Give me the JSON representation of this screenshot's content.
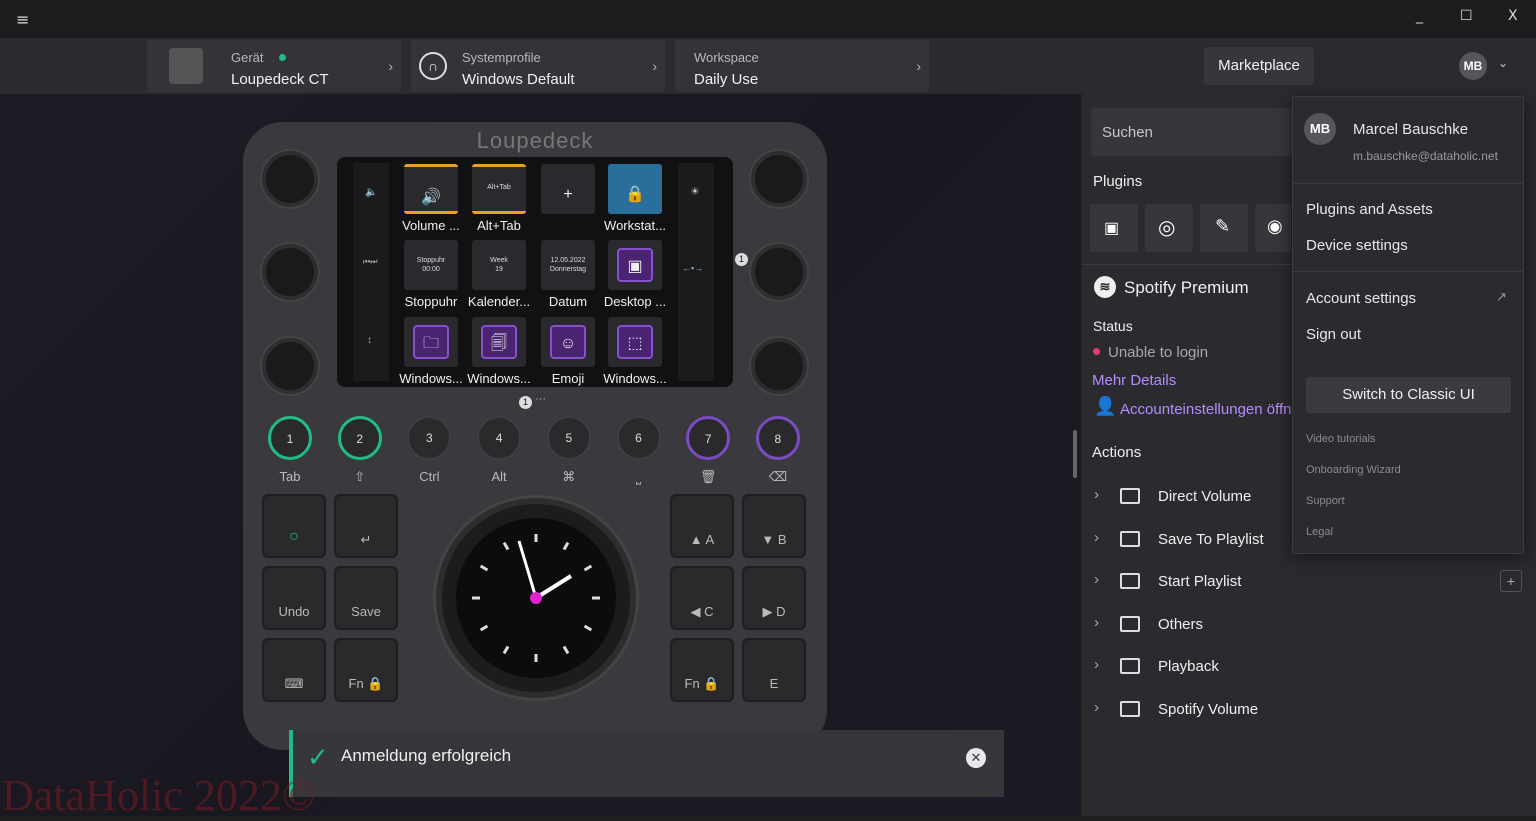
{
  "window": {
    "menu_icon": "hamburger-icon",
    "minimize": "_",
    "maximize": "☐",
    "close": "X"
  },
  "crumbs": [
    {
      "label": "Gerät",
      "value": "Loupedeck CT"
    },
    {
      "label": "Systemprofile",
      "value": "Windows Default"
    },
    {
      "label": "Workspace",
      "value": "Daily Use"
    }
  ],
  "marketplace": "Marketplace",
  "avatar_initials": "MB",
  "device": {
    "brand": "Loupedeck",
    "tiles": [
      {
        "icon": "volume-icon",
        "label": "Volume ..."
      },
      {
        "icon": "",
        "label": "Alt+Tab",
        "small": "Alt+Tab"
      },
      {
        "icon": "plus-icon",
        "label": ""
      },
      {
        "icon": "windows-lock-icon",
        "label": "Workstat..."
      },
      {
        "icon": "",
        "label": "Stoppuhr",
        "small": "Stoppuhr\n00:00"
      },
      {
        "icon": "",
        "label": "Kalender...",
        "small": "Week\n19"
      },
      {
        "icon": "",
        "label": "Datum",
        "small": "12.05.2022\nDonnerstag"
      },
      {
        "icon": "desktop-icon",
        "label": "Desktop ..."
      },
      {
        "icon": "folder-icon",
        "label": "Windows..."
      },
      {
        "icon": "files-icon",
        "label": "Windows..."
      },
      {
        "icon": "emoji-icon",
        "label": "Emoji"
      },
      {
        "icon": "snip-icon",
        "label": "Windows..."
      }
    ],
    "page_indicator": "1",
    "round_buttons": [
      {
        "n": "1",
        "label": "Tab",
        "ring": "#1fbd85"
      },
      {
        "n": "2",
        "label": "⇧",
        "ring": "#1fbd85"
      },
      {
        "n": "3",
        "label": "Ctrl",
        "ring": ""
      },
      {
        "n": "4",
        "label": "Alt",
        "ring": ""
      },
      {
        "n": "5",
        "label": "⌘",
        "ring": ""
      },
      {
        "n": "6",
        "label": "⎵",
        "ring": ""
      },
      {
        "n": "7",
        "label": "🗑",
        "ring": "#7a4cc4"
      },
      {
        "n": "8",
        "label": "⌫",
        "ring": "#7a4cc4"
      }
    ],
    "left_keys": [
      "○",
      "↵",
      "Undo",
      "Save",
      "⌨",
      "Fn 🔒"
    ],
    "right_keys": [
      "▲  A",
      "▼  B",
      "◀  C",
      "▶  D",
      "Fn 🔒",
      "E"
    ]
  },
  "right_panel": {
    "search_placeholder": "Suchen",
    "plugins_title": "Plugins",
    "plugin_icons": [
      "os-icon",
      "compass-icon",
      "wand-icon",
      "obs-icon"
    ],
    "plugin_name": "Spotify Premium",
    "status_title": "Status",
    "status_text": "Unable to login",
    "more_details": "Mehr Details",
    "account_link": "Accounteinstellungen öffn",
    "actions_title": "Actions",
    "actions": [
      "Direct Volume",
      "Save To Playlist",
      "Start Playlist",
      "Others",
      "Playback",
      "Spotify Volume"
    ]
  },
  "account_menu": {
    "name": "Marcel Bauschke",
    "email": "m.bauschke@dataholic.net",
    "items": [
      "Plugins and Assets",
      "Device settings"
    ],
    "items2": [
      "Account settings",
      "Sign out"
    ],
    "switch_button": "Switch to Classic UI",
    "small_links": [
      "Video tutorials",
      "Onboarding Wizard",
      "Support",
      "Legal"
    ]
  },
  "toast": {
    "text": "Anmeldung erfolgreich"
  },
  "watermark": "DataHolic 2022©",
  "colors": {
    "accent_green": "#1fbd85",
    "accent_purple": "#7a4cc4",
    "status_red": "#e33d6b",
    "link": "#b58cff"
  }
}
